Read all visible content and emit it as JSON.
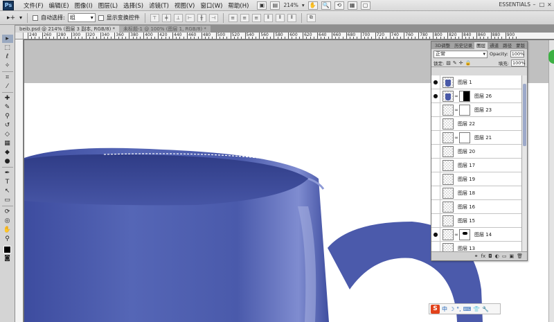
{
  "app": {
    "logo": "Ps",
    "workspace": "ESSENTIALS",
    "zoom_display": "214%"
  },
  "menu": [
    "文件(F)",
    "编辑(E)",
    "图像(I)",
    "图层(L)",
    "选择(S)",
    "滤镜(T)",
    "视图(V)",
    "窗口(W)",
    "帮助(H)"
  ],
  "window_controls": [
    "–",
    "□",
    "×"
  ],
  "options_bar": {
    "auto_select_label": "自动选择:",
    "auto_select_value": "组",
    "show_transform_label": "显示变换控件"
  },
  "tabs": [
    {
      "label": "beib.psd @ 214% (图层 3 副本, RGB/8) *",
      "active": true
    },
    {
      "label": "未标题-1 @ 100% (图层 1, RGB/8) *",
      "active": false
    }
  ],
  "ruler_labels": [
    "240",
    "260",
    "280",
    "300",
    "320",
    "340",
    "360",
    "380",
    "400",
    "420",
    "440",
    "460",
    "480",
    "500",
    "520",
    "540",
    "560",
    "580",
    "600",
    "620",
    "640",
    "660",
    "680",
    "700",
    "720",
    "740",
    "760",
    "780",
    "800",
    "820",
    "840",
    "860",
    "880",
    "900"
  ],
  "layers_panel": {
    "tabs": [
      "3D调整",
      "历史记录",
      "图层",
      "通道",
      "路径",
      "蒙版"
    ],
    "active_tab": "图层",
    "blend_mode": "正常",
    "opacity_label": "Opacity:",
    "opacity_value": "100%",
    "lock_label": "锁定:",
    "fill_label": "填充:",
    "fill_value": "100%",
    "layers": [
      {
        "name": "图层 1",
        "visible": true,
        "thumb": "cup",
        "mask": ""
      },
      {
        "name": "图层 26",
        "visible": true,
        "thumb": "cup",
        "mask": "black"
      },
      {
        "name": "图层 23",
        "visible": false,
        "thumb": "empty",
        "mask": "white"
      },
      {
        "name": "图层 22",
        "visible": false,
        "thumb": "empty",
        "mask": ""
      },
      {
        "name": "图层 21",
        "visible": false,
        "thumb": "empty",
        "mask": "white"
      },
      {
        "name": "图层 20",
        "visible": false,
        "thumb": "empty",
        "mask": ""
      },
      {
        "name": "图层 17",
        "visible": false,
        "thumb": "empty",
        "mask": ""
      },
      {
        "name": "图层 19",
        "visible": false,
        "thumb": "empty",
        "mask": ""
      },
      {
        "name": "图层 18",
        "visible": false,
        "thumb": "empty",
        "mask": ""
      },
      {
        "name": "图层 16",
        "visible": false,
        "thumb": "empty",
        "mask": ""
      },
      {
        "name": "图层 15",
        "visible": false,
        "thumb": "empty",
        "mask": ""
      },
      {
        "name": "图层 14",
        "visible": true,
        "thumb": "empty",
        "mask": "dot"
      },
      {
        "name": "图层 13",
        "visible": false,
        "thumb": "empty",
        "mask": ""
      }
    ]
  },
  "ime": {
    "logo": "S",
    "items": [
      "中",
      "☽",
      "°,",
      "⌨",
      "👕",
      "🔧"
    ]
  },
  "colors": {
    "cup": "#4d5cae",
    "canvas_bg": "#ffffff",
    "pasteboard": "#c0c0c0"
  }
}
